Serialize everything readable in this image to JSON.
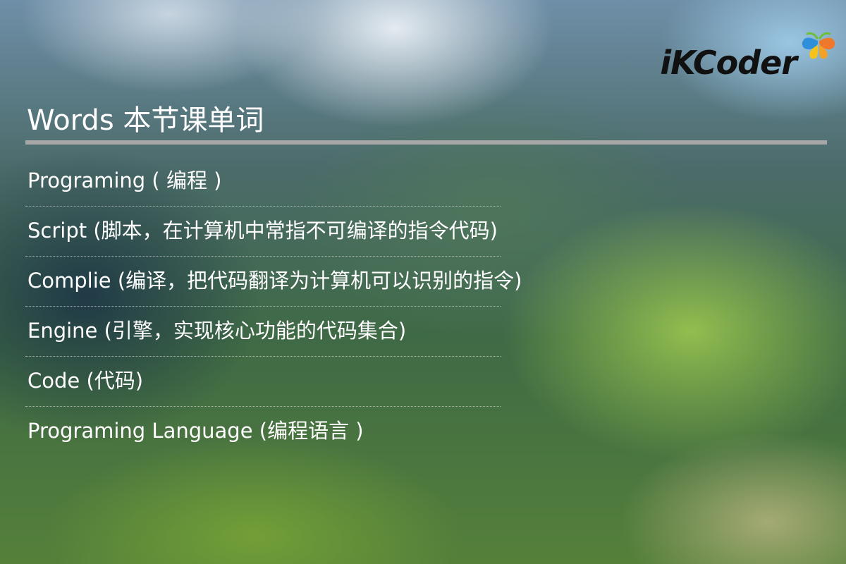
{
  "header": {
    "logo_text": "iKCoder",
    "logo_icon": "butterfly-icon",
    "title": "Words 本节课单词"
  },
  "words": [
    {
      "text": "Programing ( 编程 )"
    },
    {
      "text": "Script (脚本，在计算机中常指不可编译的指令代码)"
    },
    {
      "text": "Complie (编译，把代码翻译为计算机可以识别的指令)"
    },
    {
      "text": "Engine (引擎，实现核心功能的代码集合)"
    },
    {
      "text": "Code (代码)"
    },
    {
      "text": "Programing Language (编程语言 )"
    }
  ],
  "colors": {
    "text": "#ffffff",
    "rule": "#a7a7a7",
    "logo_text": "#111111",
    "butterfly_blue": "#2f8fd8",
    "butterfly_orange": "#f0782a",
    "butterfly_yellow": "#f6c21c",
    "butterfly_green": "#6cbf3a"
  }
}
